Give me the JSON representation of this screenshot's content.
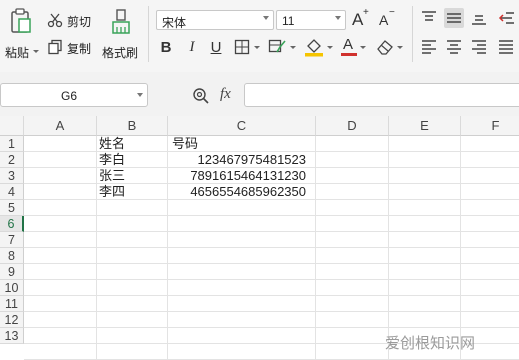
{
  "ribbon": {
    "paste_label": "粘贴",
    "cut_label": "剪切",
    "copy_label": "复制",
    "format_painter_label": "格式刷",
    "font_name": "宋体",
    "font_size": "11",
    "grow_font_glyph": "A",
    "shrink_font_glyph": "A",
    "bold_glyph": "B",
    "italic_glyph": "I",
    "underline_glyph": "U",
    "font_color_glyph": "A",
    "accent_red": "#d0312d",
    "fill_yellow": "#f5c400",
    "align_selected_bg": "#d9d9d9"
  },
  "formula_bar": {
    "name_box": "G6",
    "fx_label": "fx",
    "formula": ""
  },
  "sheet": {
    "columns": [
      "A",
      "B",
      "C",
      "D",
      "E",
      "F"
    ],
    "rows": [
      "1",
      "2",
      "3",
      "4",
      "5",
      "6",
      "7",
      "8",
      "9",
      "10",
      "11",
      "12",
      "13"
    ],
    "active_row": "6",
    "active_row_color": "#217346",
    "cells": {
      "B1": "姓名",
      "C1": "号码",
      "B2": "李白",
      "C2": "123467975481523",
      "B3": "张三",
      "C3": "7891615464131230",
      "B4": "李四",
      "C4": "4656554685962350"
    }
  },
  "watermark": "爱创根知识网"
}
